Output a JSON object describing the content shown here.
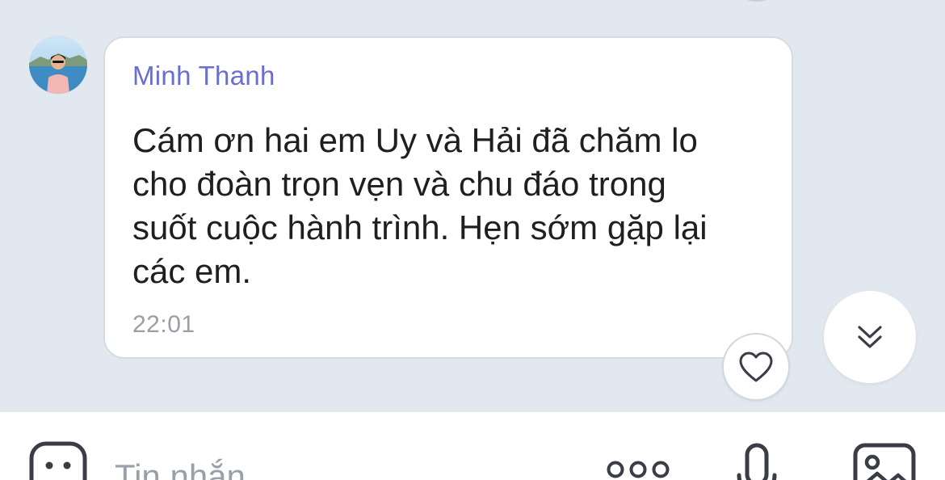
{
  "message": {
    "sender": "Minh Thanh",
    "lines": [
      "Cám ơn hai em Uy và Hải đã chăm lo",
      "cho đoàn trọn vẹn và chu đáo trong",
      "suốt cuộc hành trình. Hẹn sớm gặp lại",
      "các em."
    ],
    "time": "22:01"
  },
  "composer": {
    "placeholder": "Tin nhắn"
  },
  "icons": {
    "like": "heart-icon",
    "scroll_down": "double-chevron-down-icon",
    "emoji": "sticker-icon",
    "more": "more-horizontal-icon",
    "mic": "microphone-icon",
    "image": "image-icon"
  },
  "colors": {
    "background": "#e2e8f0",
    "bubble": "#ffffff",
    "sender_name": "#6a6ed0",
    "message_text": "#1f1f1f",
    "timestamp": "#9b9ea4",
    "icon": "#3a3d45"
  }
}
